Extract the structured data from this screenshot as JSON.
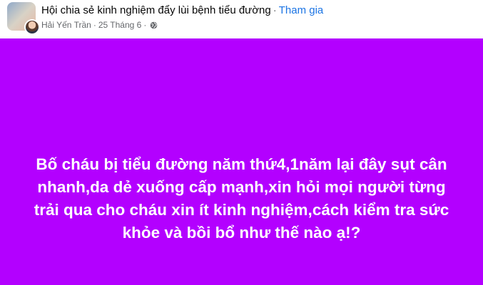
{
  "header": {
    "group_name": "Hội chia sẻ kinh nghiệm đẩy lùi bệnh tiểu đường",
    "separator": "·",
    "join_label": "Tham gia",
    "author": "Hải Yến Trần",
    "meta_separator": "·",
    "date": "25 Tháng 6",
    "privacy_icon": "globe-icon"
  },
  "post": {
    "background_color": "#b300ff",
    "text": "Bố cháu bị tiểu đường năm thứ4,1năm lại đây sụt cân nhanh,da dẻ xuống cấp mạnh,xin hỏi mọi người từng trải qua cho cháu xin ít kinh nghiệm,cách kiểm tra sức khỏe và bồi bổ như thế nào ạ!?"
  }
}
